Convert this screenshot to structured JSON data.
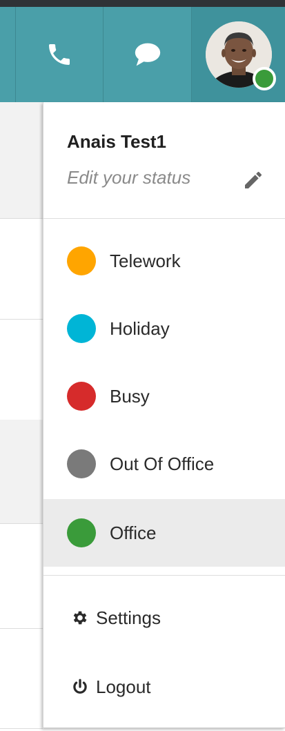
{
  "topbar": {
    "buttons": [
      {
        "icon": "phone-icon"
      },
      {
        "icon": "chat-bubble-icon"
      },
      {
        "icon": "avatar"
      }
    ],
    "presence_color": "#3a9b3a"
  },
  "user": {
    "name": "Anais Test1",
    "edit_status_placeholder": "Edit your status",
    "edit_icon": "pencil-icon"
  },
  "statuses": [
    {
      "label": "Telework",
      "color": "#ffa500",
      "active": false
    },
    {
      "label": "Holiday",
      "color": "#00b5d6",
      "active": false
    },
    {
      "label": "Busy",
      "color": "#d62b2b",
      "active": false
    },
    {
      "label": "Out Of Office",
      "color": "#7a7a7a",
      "active": false
    },
    {
      "label": "Office",
      "color": "#3a9b3a",
      "active": true
    }
  ],
  "menu": {
    "settings": {
      "label": "Settings",
      "icon": "gear-icon"
    },
    "logout": {
      "label": "Logout",
      "icon": "power-icon"
    }
  },
  "colors": {
    "topbar": "#4a9fa9",
    "topbar_border": "#2f3337"
  }
}
